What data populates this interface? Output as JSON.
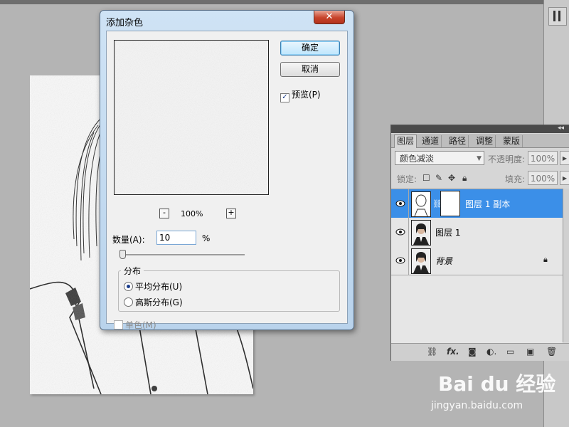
{
  "dialog": {
    "title": "添加杂色",
    "close_label": "✕",
    "ok_label": "确定",
    "cancel_label": "取消",
    "preview_checkbox_label": "预览(P)",
    "preview_checked": true,
    "zoom_minus": "-",
    "zoom_plus": "+",
    "zoom_value": "100%",
    "amount_label": "数量(A):",
    "amount_value": "10",
    "amount_unit": "%",
    "distribution_legend": "分布",
    "dist_uniform_label": "平均分布(U)",
    "dist_gaussian_label": "高斯分布(G)",
    "dist_selected": "uniform",
    "mono_label": "单色(M)",
    "mono_checked": false
  },
  "layers_panel": {
    "collapse_glyph": "◂◂",
    "tabs": [
      "图层",
      "通道",
      "路径",
      "调整",
      "蒙版"
    ],
    "blend_mode": "颜色减淡",
    "opacity_label": "不透明度:",
    "opacity_value": "100%",
    "lock_label": "锁定:",
    "fill_label": "填充:",
    "fill_value": "100%",
    "layers": [
      {
        "name": "图层 1 副本",
        "selected": true,
        "has_mask": true
      },
      {
        "name": "图层 1",
        "selected": false,
        "has_mask": false
      },
      {
        "name": "背景",
        "selected": false,
        "locked": true
      }
    ],
    "footer_icons": [
      "link-icon",
      "fx-icon",
      "mask-icon",
      "adjustment-icon",
      "group-icon",
      "new-layer-icon",
      "trash-icon"
    ]
  },
  "watermark": {
    "logo": "Bai du 经验",
    "url": "jingyan.baidu.com"
  }
}
